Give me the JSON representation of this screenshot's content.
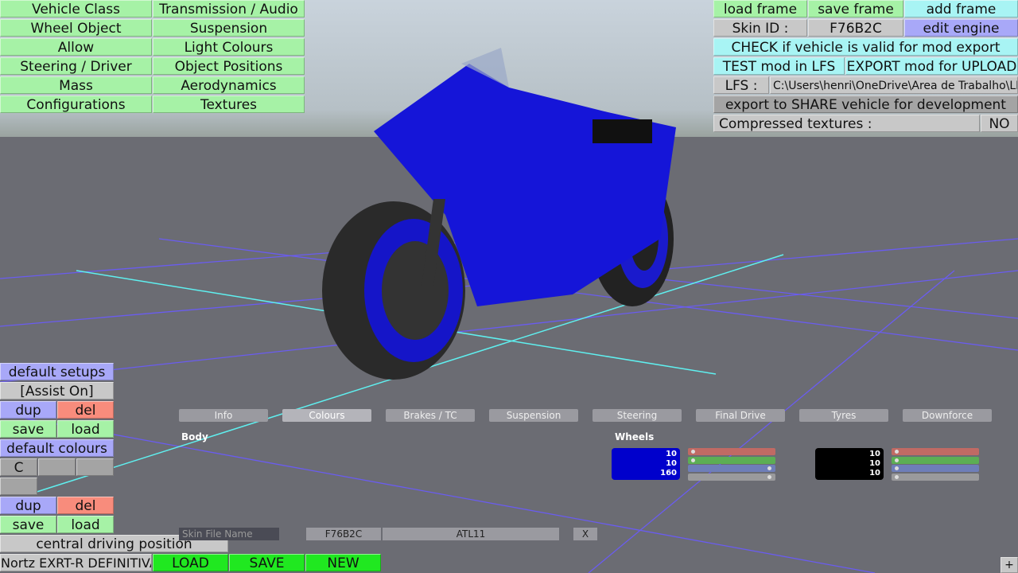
{
  "left_menu": [
    [
      "Vehicle Class",
      "Transmission / Audio"
    ],
    [
      "Wheel Object",
      "Suspension"
    ],
    [
      "Allow",
      "Light Colours"
    ],
    [
      "Steering / Driver",
      "Object Positions"
    ],
    [
      "Mass",
      "Aerodynamics"
    ],
    [
      "Configurations",
      "Textures"
    ]
  ],
  "top_right": {
    "load_frame": "load frame",
    "save_frame": "save frame",
    "add_frame": "add frame",
    "skin_id_label": "Skin ID :",
    "skin_id": "F76B2C",
    "edit_engine": "edit engine",
    "check": "CHECK if vehicle is valid for mod export",
    "test": "TEST mod in LFS",
    "export": "EXPORT mod for UPLOAD",
    "lfs_label": "LFS :",
    "lfs_path": "C:\\Users\\henri\\OneDrive\\Area de Trabalho\\LFS",
    "share": "export to SHARE vehicle for development",
    "compressed_label": "Compressed textures :",
    "compressed_value": "NO"
  },
  "left_panel": {
    "default_setups": "default setups",
    "assist": "[Assist On]",
    "dup": "dup",
    "del": "del",
    "save": "save",
    "load": "load",
    "default_colours": "default colours",
    "colour_c": "C",
    "central": "central driving position"
  },
  "bottom": {
    "vehicle_name": "Nortz EXRT-R DEFINITIVA",
    "load": "LOAD",
    "save": "SAVE",
    "new": "NEW",
    "plus": "+"
  },
  "tabs": [
    "Info",
    "Colours",
    "Brakes / TC",
    "Suspension",
    "Steering",
    "Final Drive",
    "Tyres",
    "Downforce"
  ],
  "colours": {
    "body_label": "Body",
    "wheels_label": "Wheels",
    "wheel1": {
      "color": "#0000cc",
      "values": [
        "10",
        "10",
        "160"
      ],
      "sliders": [
        0.02,
        0.02,
        0.98,
        0.98
      ]
    },
    "wheel2": {
      "color": "#000000",
      "values": [
        "10",
        "10",
        "10"
      ],
      "sliders": [
        0.02,
        0.02,
        0.02,
        0.02
      ]
    }
  },
  "skin": {
    "placeholder": "Skin File Name",
    "id": "F76B2C",
    "name": "ATL11",
    "x": "X"
  }
}
